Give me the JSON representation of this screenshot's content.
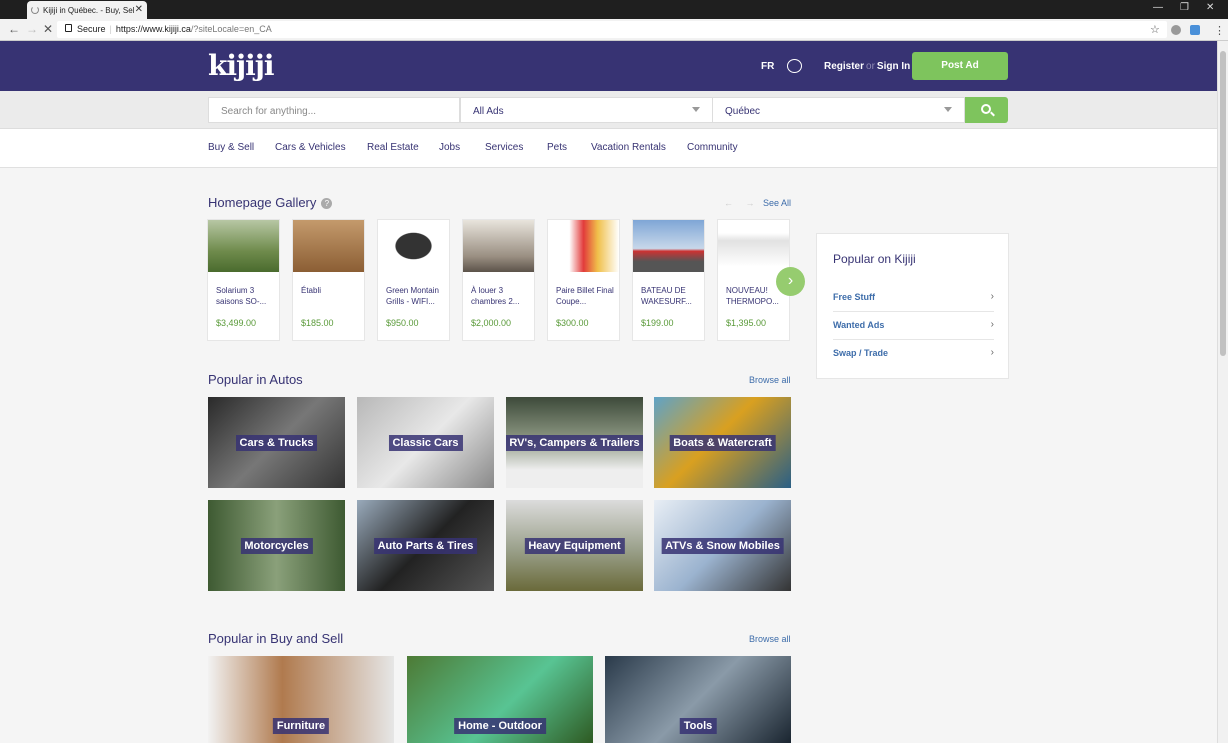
{
  "browser": {
    "tab_title": "Kijiji in Québec. - Buy, Sel",
    "secure_label": "Secure",
    "url_host": "https://www.kijiji.ca",
    "url_query": "/?siteLocale=en_CA"
  },
  "header": {
    "logo": "kijiji",
    "lang": "FR",
    "register": "Register",
    "or": "or",
    "signin": "Sign In",
    "post_ad": "Post Ad"
  },
  "search": {
    "placeholder": "Search for anything...",
    "category": "All Ads",
    "location": "Québec"
  },
  "categories": [
    "Buy & Sell",
    "Cars & Vehicles",
    "Real Estate",
    "Jobs",
    "Services",
    "Pets",
    "Vacation Rentals",
    "Community"
  ],
  "gallery": {
    "title": "Homepage Gallery",
    "see_all": "See All",
    "items": [
      {
        "name": "Solarium 3 saisons SO-...",
        "price": "$3,499.00"
      },
      {
        "name": "Établi",
        "price": "$185.00"
      },
      {
        "name": "Green Montain Grills - WIFI...",
        "price": "$950.00"
      },
      {
        "name": "À louer 3 chambres 2...",
        "price": "$2,000.00"
      },
      {
        "name": "Paire Billet Final Coupe...",
        "price": "$300.00"
      },
      {
        "name": "BATEAU DE WAKESURF...",
        "price": "$199.00"
      },
      {
        "name": "NOUVEAU! THERMOPO...",
        "price": "$1,395.00"
      }
    ]
  },
  "popular_kijiji": {
    "title": "Popular on Kijiji",
    "items": [
      "Free Stuff",
      "Wanted Ads",
      "Swap / Trade"
    ]
  },
  "autos": {
    "title": "Popular in Autos",
    "browse": "Browse all",
    "tiles": [
      "Cars & Trucks",
      "Classic Cars",
      "RV's, Campers & Trailers",
      "Boats & Watercraft",
      "Motorcycles",
      "Auto Parts & Tires",
      "Heavy Equipment",
      "ATVs & Snow Mobiles"
    ]
  },
  "buysell": {
    "title": "Popular in Buy and Sell",
    "browse": "Browse all",
    "tiles": [
      "Furniture",
      "Home - Outdoor",
      "Tools"
    ]
  }
}
